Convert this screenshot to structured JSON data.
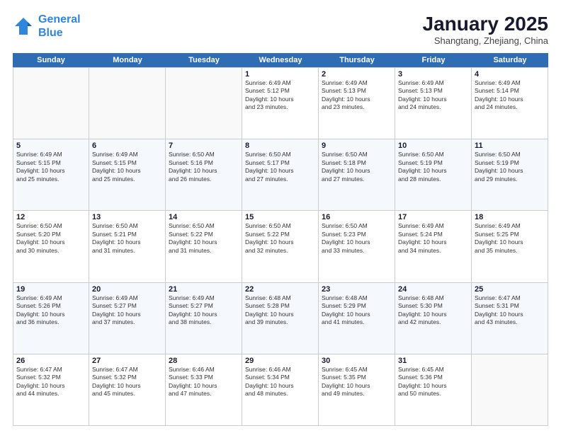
{
  "header": {
    "logo_line1": "General",
    "logo_line2": "Blue",
    "month": "January 2025",
    "location": "Shangtang, Zhejiang, China"
  },
  "day_headers": [
    "Sunday",
    "Monday",
    "Tuesday",
    "Wednesday",
    "Thursday",
    "Friday",
    "Saturday"
  ],
  "weeks": [
    {
      "cells": [
        {
          "num": "",
          "info": ""
        },
        {
          "num": "",
          "info": ""
        },
        {
          "num": "",
          "info": ""
        },
        {
          "num": "1",
          "info": "Sunrise: 6:49 AM\nSunset: 5:12 PM\nDaylight: 10 hours\nand 23 minutes."
        },
        {
          "num": "2",
          "info": "Sunrise: 6:49 AM\nSunset: 5:13 PM\nDaylight: 10 hours\nand 23 minutes."
        },
        {
          "num": "3",
          "info": "Sunrise: 6:49 AM\nSunset: 5:13 PM\nDaylight: 10 hours\nand 24 minutes."
        },
        {
          "num": "4",
          "info": "Sunrise: 6:49 AM\nSunset: 5:14 PM\nDaylight: 10 hours\nand 24 minutes."
        }
      ]
    },
    {
      "cells": [
        {
          "num": "5",
          "info": "Sunrise: 6:49 AM\nSunset: 5:15 PM\nDaylight: 10 hours\nand 25 minutes."
        },
        {
          "num": "6",
          "info": "Sunrise: 6:49 AM\nSunset: 5:15 PM\nDaylight: 10 hours\nand 25 minutes."
        },
        {
          "num": "7",
          "info": "Sunrise: 6:50 AM\nSunset: 5:16 PM\nDaylight: 10 hours\nand 26 minutes."
        },
        {
          "num": "8",
          "info": "Sunrise: 6:50 AM\nSunset: 5:17 PM\nDaylight: 10 hours\nand 27 minutes."
        },
        {
          "num": "9",
          "info": "Sunrise: 6:50 AM\nSunset: 5:18 PM\nDaylight: 10 hours\nand 27 minutes."
        },
        {
          "num": "10",
          "info": "Sunrise: 6:50 AM\nSunset: 5:19 PM\nDaylight: 10 hours\nand 28 minutes."
        },
        {
          "num": "11",
          "info": "Sunrise: 6:50 AM\nSunset: 5:19 PM\nDaylight: 10 hours\nand 29 minutes."
        }
      ]
    },
    {
      "cells": [
        {
          "num": "12",
          "info": "Sunrise: 6:50 AM\nSunset: 5:20 PM\nDaylight: 10 hours\nand 30 minutes."
        },
        {
          "num": "13",
          "info": "Sunrise: 6:50 AM\nSunset: 5:21 PM\nDaylight: 10 hours\nand 31 minutes."
        },
        {
          "num": "14",
          "info": "Sunrise: 6:50 AM\nSunset: 5:22 PM\nDaylight: 10 hours\nand 31 minutes."
        },
        {
          "num": "15",
          "info": "Sunrise: 6:50 AM\nSunset: 5:22 PM\nDaylight: 10 hours\nand 32 minutes."
        },
        {
          "num": "16",
          "info": "Sunrise: 6:50 AM\nSunset: 5:23 PM\nDaylight: 10 hours\nand 33 minutes."
        },
        {
          "num": "17",
          "info": "Sunrise: 6:49 AM\nSunset: 5:24 PM\nDaylight: 10 hours\nand 34 minutes."
        },
        {
          "num": "18",
          "info": "Sunrise: 6:49 AM\nSunset: 5:25 PM\nDaylight: 10 hours\nand 35 minutes."
        }
      ]
    },
    {
      "cells": [
        {
          "num": "19",
          "info": "Sunrise: 6:49 AM\nSunset: 5:26 PM\nDaylight: 10 hours\nand 36 minutes."
        },
        {
          "num": "20",
          "info": "Sunrise: 6:49 AM\nSunset: 5:27 PM\nDaylight: 10 hours\nand 37 minutes."
        },
        {
          "num": "21",
          "info": "Sunrise: 6:49 AM\nSunset: 5:27 PM\nDaylight: 10 hours\nand 38 minutes."
        },
        {
          "num": "22",
          "info": "Sunrise: 6:48 AM\nSunset: 5:28 PM\nDaylight: 10 hours\nand 39 minutes."
        },
        {
          "num": "23",
          "info": "Sunrise: 6:48 AM\nSunset: 5:29 PM\nDaylight: 10 hours\nand 41 minutes."
        },
        {
          "num": "24",
          "info": "Sunrise: 6:48 AM\nSunset: 5:30 PM\nDaylight: 10 hours\nand 42 minutes."
        },
        {
          "num": "25",
          "info": "Sunrise: 6:47 AM\nSunset: 5:31 PM\nDaylight: 10 hours\nand 43 minutes."
        }
      ]
    },
    {
      "cells": [
        {
          "num": "26",
          "info": "Sunrise: 6:47 AM\nSunset: 5:32 PM\nDaylight: 10 hours\nand 44 minutes."
        },
        {
          "num": "27",
          "info": "Sunrise: 6:47 AM\nSunset: 5:32 PM\nDaylight: 10 hours\nand 45 minutes."
        },
        {
          "num": "28",
          "info": "Sunrise: 6:46 AM\nSunset: 5:33 PM\nDaylight: 10 hours\nand 47 minutes."
        },
        {
          "num": "29",
          "info": "Sunrise: 6:46 AM\nSunset: 5:34 PM\nDaylight: 10 hours\nand 48 minutes."
        },
        {
          "num": "30",
          "info": "Sunrise: 6:45 AM\nSunset: 5:35 PM\nDaylight: 10 hours\nand 49 minutes."
        },
        {
          "num": "31",
          "info": "Sunrise: 6:45 AM\nSunset: 5:36 PM\nDaylight: 10 hours\nand 50 minutes."
        },
        {
          "num": "",
          "info": ""
        }
      ]
    }
  ]
}
